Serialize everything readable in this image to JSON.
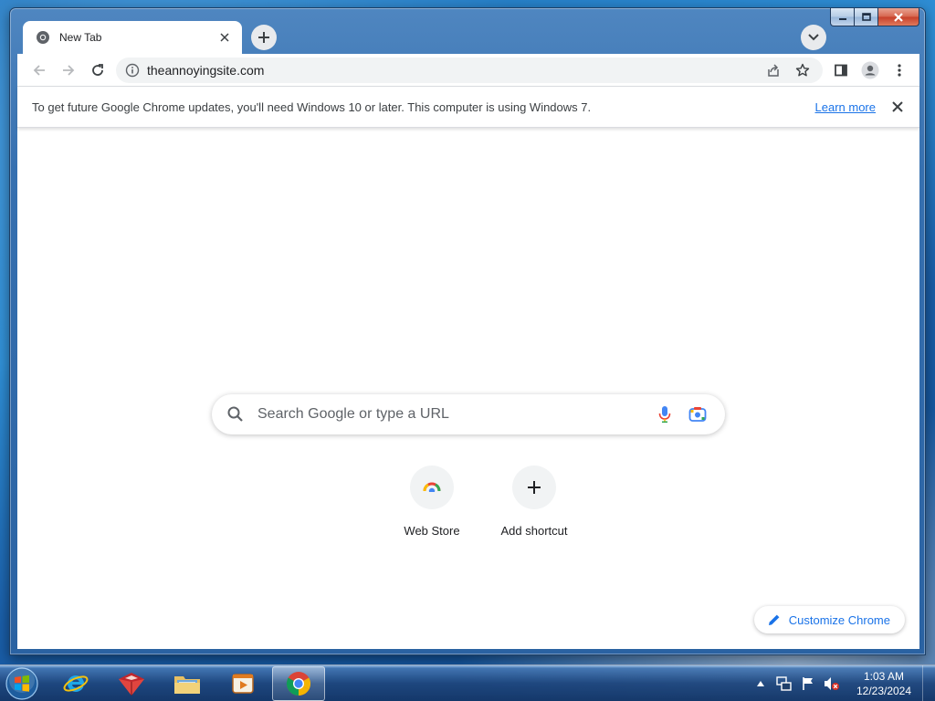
{
  "browser": {
    "tab": {
      "title": "New Tab",
      "favicon": "chrome-icon"
    },
    "toolbar": {
      "url": "theannoyingsite.com",
      "back_icon": "back-arrow-icon",
      "forward_icon": "forward-arrow-icon",
      "reload_icon": "reload-icon"
    },
    "infobar": {
      "message": "To get future Google Chrome updates, you'll need Windows 10 or later. This computer is using Windows 7.",
      "link": "Learn more"
    }
  },
  "ntp": {
    "search_placeholder": "Search Google or type a URL",
    "shortcuts": [
      {
        "label": "Web Store",
        "icon": "web-store-icon"
      },
      {
        "label": "Add shortcut",
        "icon": "plus-icon"
      }
    ],
    "customize_label": "Customize Chrome"
  },
  "taskbar": {
    "apps": [
      {
        "name": "internet-explorer",
        "icon": "ie-icon"
      },
      {
        "name": "tools",
        "icon": "toolbox-icon"
      },
      {
        "name": "file-explorer",
        "icon": "folder-icon"
      },
      {
        "name": "media-player",
        "icon": "media-player-icon"
      },
      {
        "name": "google-chrome",
        "icon": "chrome-icon",
        "active": true
      }
    ],
    "clock": {
      "time": "1:03 AM",
      "date": "12/23/2024"
    }
  },
  "colors": {
    "accent": "#1a73e8",
    "text": "#202124"
  }
}
